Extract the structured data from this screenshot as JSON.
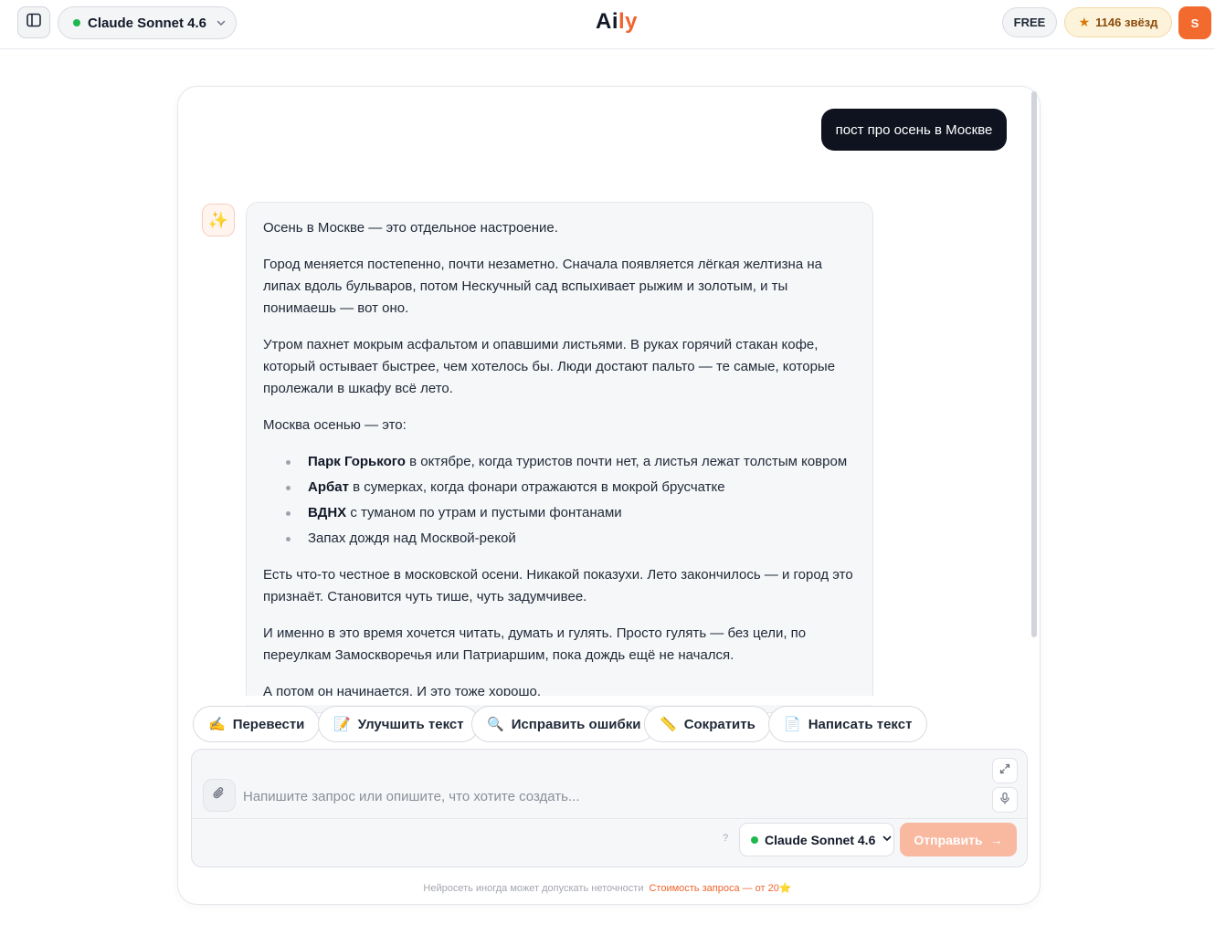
{
  "header": {
    "model_name": "Claude Sonnet 4.6",
    "logo_part1": "Ai",
    "logo_part2": "ly",
    "plan_badge": "FREE",
    "stars_label": "1146 звёзд",
    "avatar_initial": "S"
  },
  "chat": {
    "user_message": "пост про осень в Москве",
    "ai_avatar_emoji": "✨",
    "ai": {
      "p1": "Осень в Москве — это отдельное настроение.",
      "p2": "Город меняется постепенно, почти незаметно. Сначала появляется лёгкая желтизна на липах вдоль бульваров, потом Нескучный сад вспыхивает рыжим и золотым, и ты понимаешь — вот оно.",
      "p3": "Утром пахнет мокрым асфальтом и опавшими листьями. В руках горячий стакан кофе, который остывает быстрее, чем хотелось бы. Люди достают пальто — те самые, которые пролежали в шкафу всё лето.",
      "p4": "Москва осенью — это:",
      "list": [
        {
          "bold": "Парк Горького",
          "rest": " в октябре, когда туристов почти нет, а листья лежат толстым ковром"
        },
        {
          "bold": "Арбат",
          "rest": " в сумерках, когда фонари отражаются в мокрой брусчатке"
        },
        {
          "bold": "ВДНХ",
          "rest": " с туманом по утрам и пустыми фонтанами"
        },
        {
          "bold": "",
          "rest": "Запах дождя над Москвой-рекой"
        }
      ],
      "p5": "Есть что-то честное в московской осени. Никакой показухи. Лето закончилось — и город это признаёт. Становится чуть тише, чуть задумчивее.",
      "p6": "И именно в это время хочется читать, думать и гулять. Просто гулять — без цели, по переулкам Замоскворечья или Патриаршим, пока дождь ещё не начался.",
      "p7": "А потом он начинается. И это тоже хорошо."
    }
  },
  "quick_actions": [
    {
      "emoji": "✍️",
      "label": "Перевести"
    },
    {
      "emoji": "📝",
      "label": "Улучшить текст"
    },
    {
      "emoji": "🔍",
      "label": "Исправить ошибки"
    },
    {
      "emoji": "📏",
      "label": "Сократить"
    },
    {
      "emoji": "📄",
      "label": "Написать текст"
    }
  ],
  "composer": {
    "placeholder": "Напишите запрос или опишите, что хотите создать...",
    "value": "",
    "help_label": "?",
    "model_name": "Claude Sonnet 4.6",
    "send_label": "Отправить",
    "send_arrow": "→"
  },
  "footer": {
    "disclaimer": "Нейросеть иногда может допускать неточности",
    "cost": "Стоимость запроса — от 20⭐"
  },
  "colors": {
    "accent": "#f0642d",
    "online": "#1fb84f",
    "user_bubble": "#0f1320",
    "send_disabled": "#f9b8a0"
  },
  "icons": [
    "sidebar-icon",
    "chevron-down-icon",
    "star-icon",
    "sparkles-icon",
    "paperclip-icon",
    "expand-icon",
    "microphone-icon",
    "arrow-right-icon"
  ]
}
